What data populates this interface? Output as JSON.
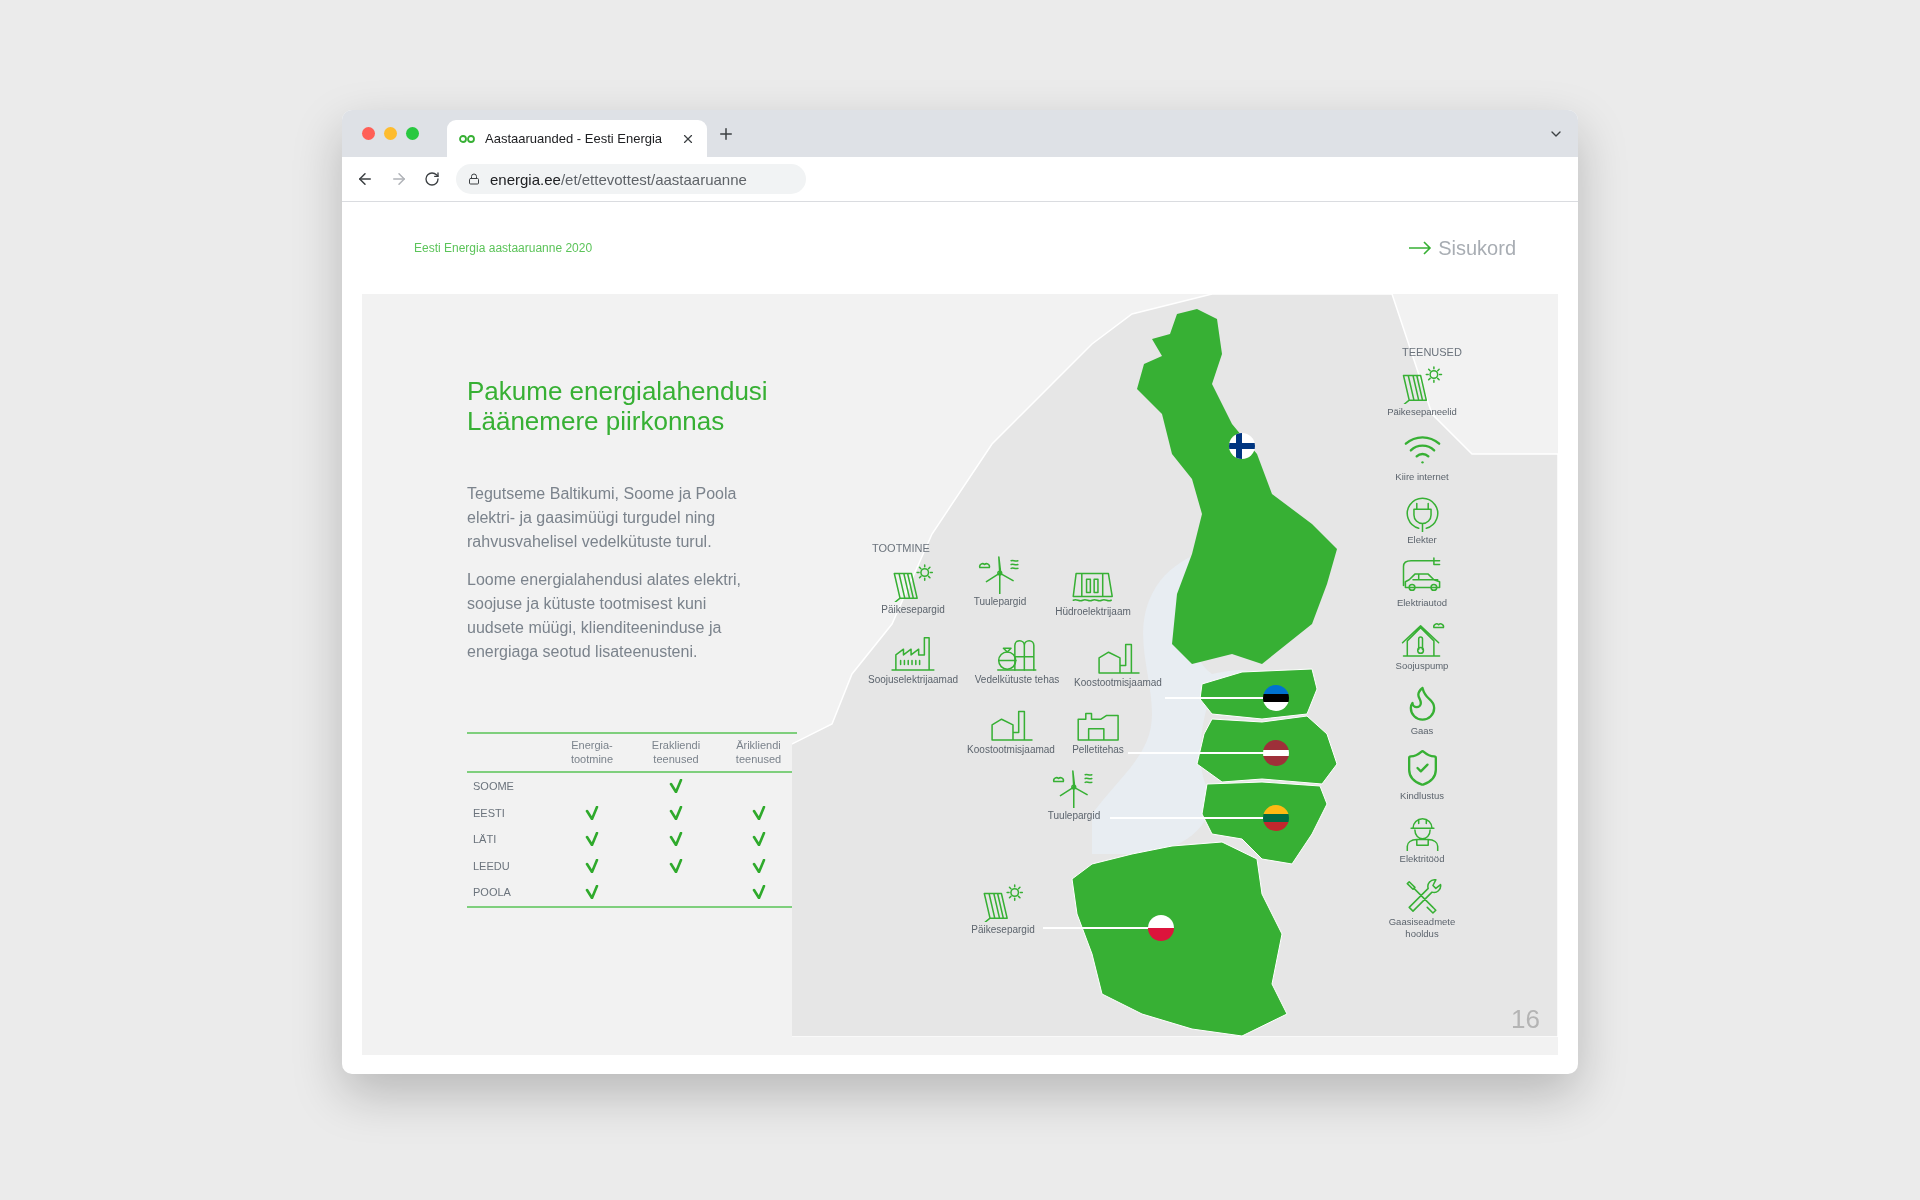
{
  "browser": {
    "tab_title": "Aastaaruanded - Eesti Energia",
    "url_host": "energia.ee",
    "url_path": "/et/ettevottest/aastaaruanne"
  },
  "header": {
    "report_title": "Eesti Energia aastaaruanne 2020",
    "toc_link": "Sisukord"
  },
  "heading": [
    "Pakume energialahendusi",
    "Läänemere piirkonnas"
  ],
  "paragraphs": [
    "Tegutseme Baltikumi, Soome ja Poola elektri- ja gaasimüügi turgudel ning rahvusvahelisel vedelkütuste turul.",
    "Loome energialahendusi alates elektri, soojuse ja kütuste tootmisest kuni uudsete müügi, klienditeeninduse ja energiaga seotud lisateenusteni."
  ],
  "table": {
    "columns": [
      "Energia-tootmine",
      "Erakliendi teenused",
      "Ärikliendi teenused"
    ],
    "rows": [
      {
        "country": "SOOME",
        "checks": [
          false,
          true,
          false
        ]
      },
      {
        "country": "EESTI",
        "checks": [
          true,
          true,
          true
        ]
      },
      {
        "country": "LÄTI",
        "checks": [
          true,
          true,
          true
        ]
      },
      {
        "country": "LEEDU",
        "checks": [
          true,
          true,
          true
        ]
      },
      {
        "country": "POOLA",
        "checks": [
          true,
          false,
          true
        ]
      }
    ]
  },
  "production": {
    "title": "TOOTMINE",
    "items": [
      "Päikesepargid",
      "Tuulepargid",
      "Hüdroelektrijaam",
      "Soojuselektrijaamad",
      "Vedelkütuste tehas",
      "Koostootmisjaamad",
      "Koostootmisjaamad",
      "Pelletitehas",
      "Tuulepargid",
      "Päikesepargid"
    ]
  },
  "services": {
    "title": "TEENUSED",
    "items": [
      "Päikesepaneelid",
      "Kiire internet",
      "Elekter",
      "Elektriautod",
      "Soojuspump",
      "Gaas",
      "Kindlustus",
      "Elektritööd",
      "Gaasiseadmete hooldus"
    ]
  },
  "page_number": "16"
}
